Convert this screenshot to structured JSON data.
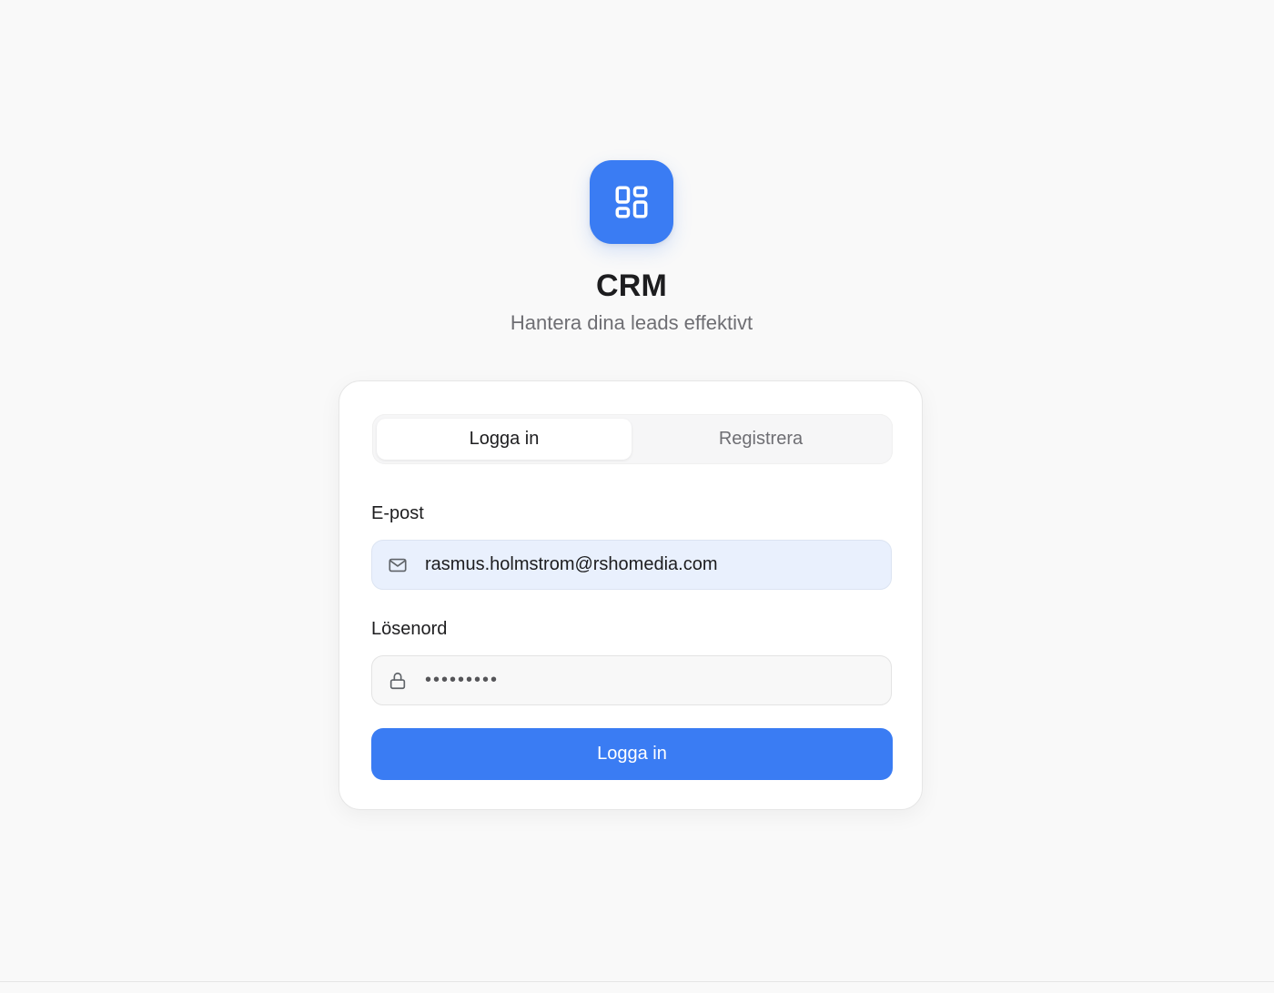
{
  "app": {
    "title": "CRM",
    "subtitle": "Hantera dina leads effektivt",
    "logo_icon": "dashboard-grid-icon",
    "accent_color": "#3a7cf3"
  },
  "auth_tabs": {
    "login_label": "Logga in",
    "register_label": "Registrera",
    "active_tab": "login"
  },
  "form": {
    "email": {
      "label": "E-post",
      "value": "rasmus.holmstrom@rshomedia.com",
      "icon": "mail-icon"
    },
    "password": {
      "label": "Lösenord",
      "masked_value": "•••••••••",
      "icon": "lock-icon"
    },
    "submit_label": "Logga in"
  }
}
